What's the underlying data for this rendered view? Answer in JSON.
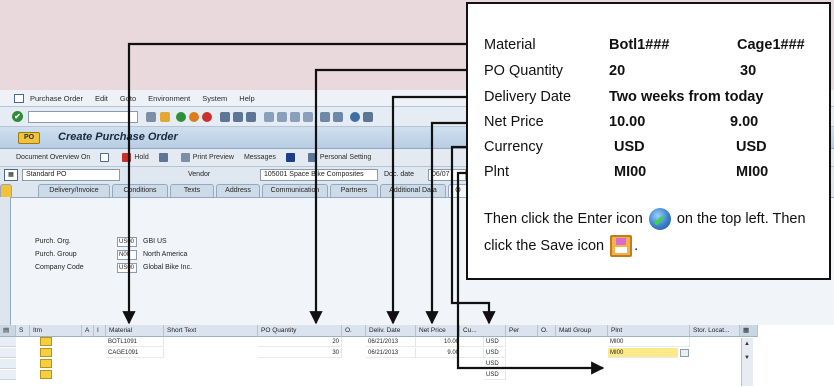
{
  "menu": [
    "Purchase Order",
    "Edit",
    "Goto",
    "Environment",
    "System",
    "Help"
  ],
  "title": "Create Purchase Order",
  "app_toolbar": {
    "doc_overview": "Document Overview On",
    "hold": "Hold",
    "print_preview": "Print Preview",
    "messages": "Messages",
    "personal_setting": "Personal Setting"
  },
  "header": {
    "doc_type": "Standard PO",
    "vendor_label": "Vendor",
    "vendor_value": "105001 Space Bike Composites",
    "doc_date_label": "Doc. date",
    "doc_date_value": "06/07"
  },
  "tabs": [
    "Delivery/Invoice",
    "Conditions",
    "Texts",
    "Address",
    "Communication",
    "Partners",
    "Additional Data",
    "O"
  ],
  "org": [
    {
      "label": "Purch. Org.",
      "code": "US00",
      "desc": "GBI US"
    },
    {
      "label": "Purch. Group",
      "code": "N00",
      "desc": "North America"
    },
    {
      "label": "Company Code",
      "code": "US00",
      "desc": "Global Bike Inc."
    }
  ],
  "grid": {
    "headers": [
      "S",
      "Itm",
      "A",
      "I",
      "Material",
      "Short Text",
      "PO Quantity",
      "O.",
      "Deliv. Date",
      "Net Price",
      "Cu...",
      "Per",
      "O.",
      "Matl Group",
      "Plnt",
      "Stor. Locat..."
    ],
    "rows": [
      {
        "material": "BOTL1091",
        "qty": "20",
        "date": "06/21/2013",
        "price": "10.00",
        "curr": "USD",
        "plant": "MI00"
      },
      {
        "material": "CAGE1091",
        "qty": "30",
        "date": "06/21/2013",
        "price": "9.00",
        "curr": "USD",
        "plant": "MI00"
      },
      {
        "material": "",
        "qty": "",
        "date": "",
        "price": "",
        "curr": "USD",
        "plant": ""
      },
      {
        "material": "",
        "qty": "",
        "date": "",
        "price": "",
        "curr": "USD",
        "plant": ""
      }
    ]
  },
  "instructions": {
    "rows": [
      {
        "label": "Material",
        "v1": "Botl1###",
        "v2": "Cage1###"
      },
      {
        "label": "PO Quantity",
        "v1": "20",
        "v2": "30"
      },
      {
        "label": "Delivery Date",
        "v1": "Two weeks from today",
        "v2": ""
      },
      {
        "label": "Net Price",
        "v1": "10.00",
        "v2": "9.00"
      },
      {
        "label": "Currency",
        "v1": "USD",
        "v2": "USD"
      },
      {
        "label": "Plnt",
        "v1": "MI00",
        "v2": "MI00"
      }
    ],
    "note_a": "Then click the Enter icon",
    "note_b": "on the top left. Then click the Save icon",
    "note_c": "."
  }
}
